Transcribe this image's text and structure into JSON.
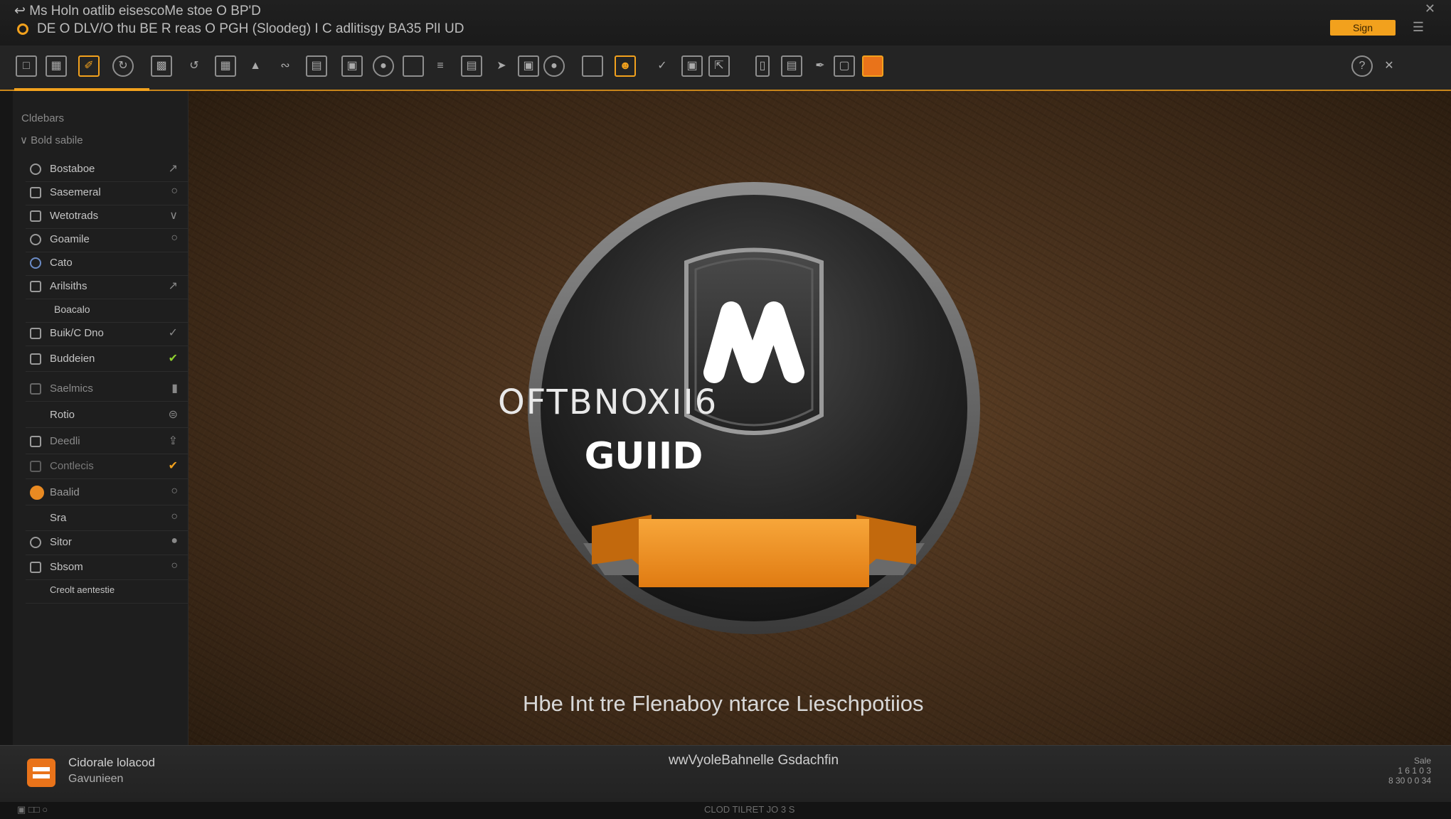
{
  "window": {
    "title": "Ms Holn oatlib eisescoMe stoe O BP'D",
    "subtitle": "DE O DLV/O thu BE R reas O PGH (Sloodeg) I C adlitisgy BA35 PlI UD",
    "top_button": "Sign"
  },
  "toolbar": {
    "icons": [
      "page-icon",
      "calendar-icon",
      "brush-icon",
      "refresh-icon",
      "layers-icon",
      "undo-icon",
      "grid-icon",
      "shape-icon",
      "path-icon",
      "clipboard-icon",
      "image-icon",
      "comment-icon",
      "frame-icon",
      "text-icon",
      "print-icon",
      "arrow-icon",
      "crop-icon",
      "zoom-icon",
      "square-icon",
      "user-icon",
      "check-icon",
      "copy-icon",
      "resize-icon",
      "phone-icon",
      "save-icon",
      "pen-icon",
      "folder-icon",
      "home-icon"
    ],
    "right_icons": [
      "help-icon",
      "exit-icon"
    ]
  },
  "sidebar": {
    "heading": "Cldebars",
    "subheading": "Bold sabile",
    "items": [
      {
        "label": "Bostaboe",
        "icon": "pin-icon"
      },
      {
        "label": "Sasemeral",
        "icon": "image-icon"
      },
      {
        "label": "Wetotrads",
        "icon": "camera-icon"
      },
      {
        "label": "Goamile",
        "icon": "globe-icon"
      },
      {
        "label": "Cato",
        "icon": "info-icon"
      },
      {
        "label": "Arilsiths",
        "icon": "table-icon"
      },
      {
        "label": "Boacalo",
        "icon": "sub-icon"
      },
      {
        "label": "Buik/C Dno",
        "icon": "box-icon"
      },
      {
        "label": "Buddeien",
        "icon": "tray-icon"
      },
      {
        "label": "Saelmics",
        "icon": "list-icon"
      },
      {
        "label": "Rotio",
        "icon": "arrow-icon"
      },
      {
        "label": "Deedli",
        "icon": "photo-icon"
      },
      {
        "label": "Contlecis",
        "icon": "hand-icon"
      },
      {
        "label": "Baalid",
        "icon": "orange-circle-icon"
      },
      {
        "label": "Sra",
        "icon": "triangle-icon"
      },
      {
        "label": "Sitor",
        "icon": "settings-icon"
      },
      {
        "label": "Sbsom",
        "icon": "mixer-icon"
      },
      {
        "label": "Creolt aentestie",
        "icon": "pen-icon"
      }
    ]
  },
  "canvas": {
    "badge_title": "OFTBNOXII6",
    "badge_ribbon": "GUIID",
    "tagline": "Hbe Int tre Flenaboy ntarce Lieschpotiios",
    "colors": {
      "accent": "#f2a11d",
      "badge_dark": "#2a2a2a",
      "background": "#4a321d"
    }
  },
  "bottom_panel": {
    "line1": "Cidorale lolacod",
    "line2": "Gavunieen",
    "url": "wwVyoleBahnelle Gsdachfin",
    "right_line1": "Sale",
    "right_line2": "1 6 1 0 3",
    "right_line3": "8 30 0 0 34"
  },
  "status": {
    "center": "CLOD TILRET JO 3 S"
  }
}
